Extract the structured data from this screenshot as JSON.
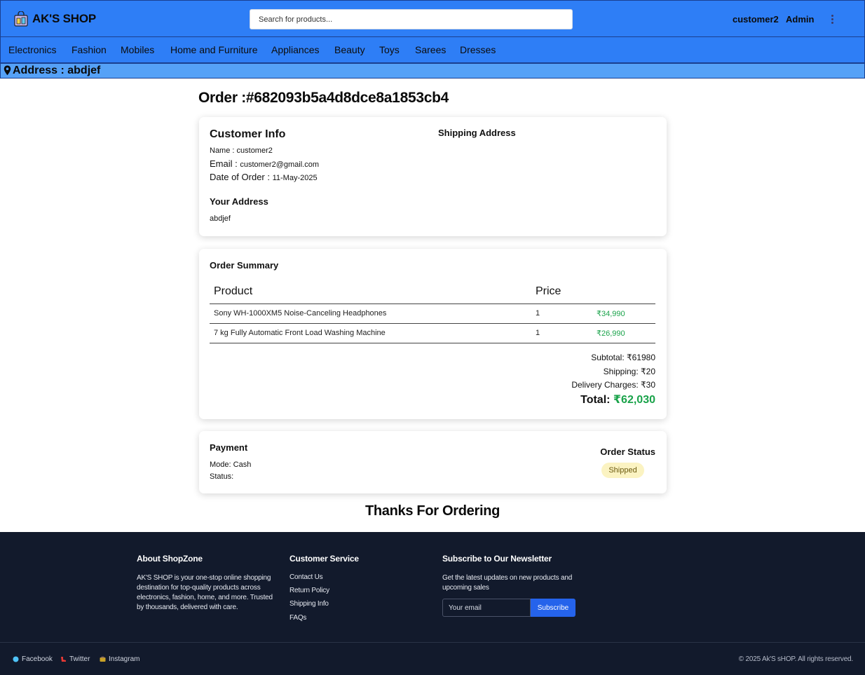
{
  "header": {
    "brand": "AK'S SHOP",
    "search_placeholder": "Search for products...",
    "user": "customer2",
    "admin": "Admin"
  },
  "categories": [
    "Electronics",
    "Fashion",
    "Mobiles",
    "Home and Furniture",
    "Appliances",
    "Beauty",
    "Toys",
    "Sarees",
    "Dresses"
  ],
  "address_bar": "Address : abdjef",
  "order": {
    "title": "Order :#682093b5a4d8dce8a1853cb4",
    "customer_info": {
      "heading": "Customer Info",
      "name_label": "Name : ",
      "name": "customer2",
      "email_label": "Email : ",
      "email": "customer2@gmail.com",
      "date_label": "Date of Order : ",
      "date": "11-May-2025",
      "shipping_heading": "Shipping Address",
      "your_address_heading": "Your Address",
      "your_address": "abdjef"
    },
    "summary": {
      "heading": "Order Summary",
      "col_product": "Product",
      "col_price": "Price",
      "items": [
        {
          "product": "Sony WH-1000XM5 Noise-Canceling Headphones",
          "qty": "1",
          "price": "₹34,990"
        },
        {
          "product": "7 kg Fully Automatic Front Load Washing Machine",
          "qty": "1",
          "price": "₹26,990"
        }
      ],
      "subtotal": "Subtotal: ₹61980",
      "shipping": "Shipping: ₹20",
      "delivery": "Delivery Charges: ₹30",
      "total_label": "Total: ",
      "total_value": "₹62,030"
    },
    "payment": {
      "heading": "Payment",
      "mode": "Mode: Cash",
      "status": "Status:",
      "order_status_heading": "Order Status",
      "order_status": "Shipped"
    },
    "thanks": "Thanks For Ordering"
  },
  "footer": {
    "about_heading": "About ShopZone",
    "about_text": "AK'S SHOP is your one-stop online shopping destination for top-quality products across electronics, fashion, home, and more. Trusted by thousands, delivered with care.",
    "service_heading": "Customer Service",
    "service_links": [
      "Contact Us",
      "Return Policy",
      "Shipping Info",
      "FAQs"
    ],
    "newsletter_heading": "Subscribe to Our Newsletter",
    "newsletter_text": "Get the latest updates on new products and upcoming sales",
    "email_placeholder": "Your email",
    "subscribe_label": "Subscribe",
    "social": [
      "Facebook",
      "Twitter",
      "Instagram"
    ],
    "copyright": "© 2025 Ak'S sHOP. All rights reserved."
  },
  "colors": {
    "header_blue": "#2e7ef6",
    "address_blue": "#55a1f7",
    "price_green": "#1aa34a",
    "footer_bg": "#121a2c",
    "subscribe_blue": "#2563eb",
    "badge_bg": "#fbf3c2"
  }
}
